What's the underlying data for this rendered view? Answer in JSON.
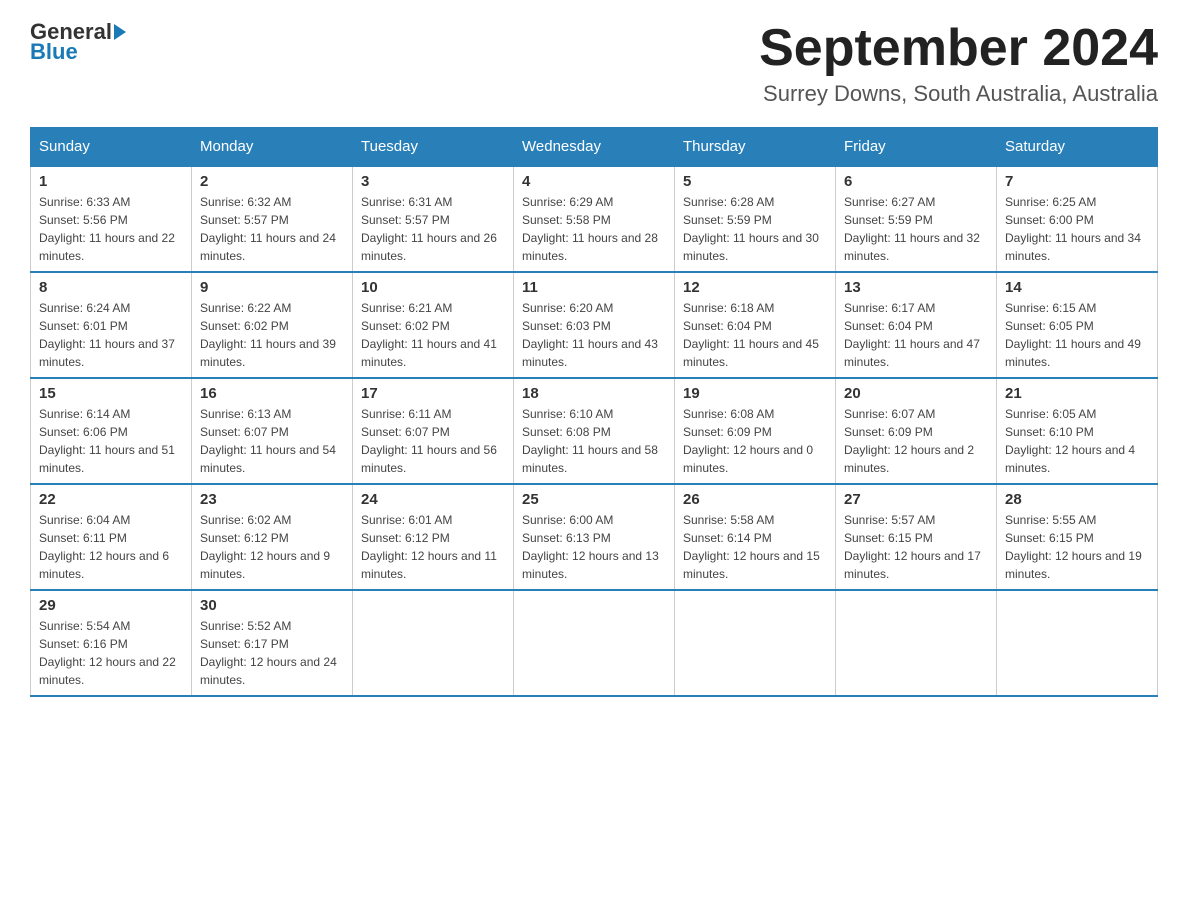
{
  "header": {
    "logo_line1": "General",
    "logo_line2": "Blue",
    "month_title": "September 2024",
    "location": "Surrey Downs, South Australia, Australia"
  },
  "weekdays": [
    "Sunday",
    "Monday",
    "Tuesday",
    "Wednesday",
    "Thursday",
    "Friday",
    "Saturday"
  ],
  "weeks": [
    [
      {
        "day": "1",
        "sunrise": "6:33 AM",
        "sunset": "5:56 PM",
        "daylight": "11 hours and 22 minutes."
      },
      {
        "day": "2",
        "sunrise": "6:32 AM",
        "sunset": "5:57 PM",
        "daylight": "11 hours and 24 minutes."
      },
      {
        "day": "3",
        "sunrise": "6:31 AM",
        "sunset": "5:57 PM",
        "daylight": "11 hours and 26 minutes."
      },
      {
        "day": "4",
        "sunrise": "6:29 AM",
        "sunset": "5:58 PM",
        "daylight": "11 hours and 28 minutes."
      },
      {
        "day": "5",
        "sunrise": "6:28 AM",
        "sunset": "5:59 PM",
        "daylight": "11 hours and 30 minutes."
      },
      {
        "day": "6",
        "sunrise": "6:27 AM",
        "sunset": "5:59 PM",
        "daylight": "11 hours and 32 minutes."
      },
      {
        "day": "7",
        "sunrise": "6:25 AM",
        "sunset": "6:00 PM",
        "daylight": "11 hours and 34 minutes."
      }
    ],
    [
      {
        "day": "8",
        "sunrise": "6:24 AM",
        "sunset": "6:01 PM",
        "daylight": "11 hours and 37 minutes."
      },
      {
        "day": "9",
        "sunrise": "6:22 AM",
        "sunset": "6:02 PM",
        "daylight": "11 hours and 39 minutes."
      },
      {
        "day": "10",
        "sunrise": "6:21 AM",
        "sunset": "6:02 PM",
        "daylight": "11 hours and 41 minutes."
      },
      {
        "day": "11",
        "sunrise": "6:20 AM",
        "sunset": "6:03 PM",
        "daylight": "11 hours and 43 minutes."
      },
      {
        "day": "12",
        "sunrise": "6:18 AM",
        "sunset": "6:04 PM",
        "daylight": "11 hours and 45 minutes."
      },
      {
        "day": "13",
        "sunrise": "6:17 AM",
        "sunset": "6:04 PM",
        "daylight": "11 hours and 47 minutes."
      },
      {
        "day": "14",
        "sunrise": "6:15 AM",
        "sunset": "6:05 PM",
        "daylight": "11 hours and 49 minutes."
      }
    ],
    [
      {
        "day": "15",
        "sunrise": "6:14 AM",
        "sunset": "6:06 PM",
        "daylight": "11 hours and 51 minutes."
      },
      {
        "day": "16",
        "sunrise": "6:13 AM",
        "sunset": "6:07 PM",
        "daylight": "11 hours and 54 minutes."
      },
      {
        "day": "17",
        "sunrise": "6:11 AM",
        "sunset": "6:07 PM",
        "daylight": "11 hours and 56 minutes."
      },
      {
        "day": "18",
        "sunrise": "6:10 AM",
        "sunset": "6:08 PM",
        "daylight": "11 hours and 58 minutes."
      },
      {
        "day": "19",
        "sunrise": "6:08 AM",
        "sunset": "6:09 PM",
        "daylight": "12 hours and 0 minutes."
      },
      {
        "day": "20",
        "sunrise": "6:07 AM",
        "sunset": "6:09 PM",
        "daylight": "12 hours and 2 minutes."
      },
      {
        "day": "21",
        "sunrise": "6:05 AM",
        "sunset": "6:10 PM",
        "daylight": "12 hours and 4 minutes."
      }
    ],
    [
      {
        "day": "22",
        "sunrise": "6:04 AM",
        "sunset": "6:11 PM",
        "daylight": "12 hours and 6 minutes."
      },
      {
        "day": "23",
        "sunrise": "6:02 AM",
        "sunset": "6:12 PM",
        "daylight": "12 hours and 9 minutes."
      },
      {
        "day": "24",
        "sunrise": "6:01 AM",
        "sunset": "6:12 PM",
        "daylight": "12 hours and 11 minutes."
      },
      {
        "day": "25",
        "sunrise": "6:00 AM",
        "sunset": "6:13 PM",
        "daylight": "12 hours and 13 minutes."
      },
      {
        "day": "26",
        "sunrise": "5:58 AM",
        "sunset": "6:14 PM",
        "daylight": "12 hours and 15 minutes."
      },
      {
        "day": "27",
        "sunrise": "5:57 AM",
        "sunset": "6:15 PM",
        "daylight": "12 hours and 17 minutes."
      },
      {
        "day": "28",
        "sunrise": "5:55 AM",
        "sunset": "6:15 PM",
        "daylight": "12 hours and 19 minutes."
      }
    ],
    [
      {
        "day": "29",
        "sunrise": "5:54 AM",
        "sunset": "6:16 PM",
        "daylight": "12 hours and 22 minutes."
      },
      {
        "day": "30",
        "sunrise": "5:52 AM",
        "sunset": "6:17 PM",
        "daylight": "12 hours and 24 minutes."
      },
      null,
      null,
      null,
      null,
      null
    ]
  ],
  "labels": {
    "sunrise_prefix": "Sunrise: ",
    "sunset_prefix": "Sunset: ",
    "daylight_prefix": "Daylight: "
  }
}
